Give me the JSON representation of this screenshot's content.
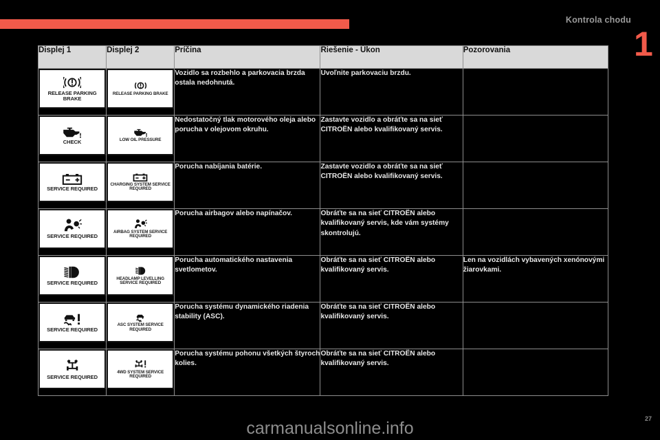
{
  "page": {
    "chapter_title": "Kontrola chodu",
    "chapter_number": "1",
    "page_number": "27",
    "watermark": "carmanualsonline.info",
    "accent_color": "#f15a4a",
    "header_bg": "#d9d9d9"
  },
  "table": {
    "headers": [
      "Displej 1",
      "Displej 2",
      "Príčina",
      "Riešenie - Úkon",
      "Pozorovania"
    ],
    "rows": [
      {
        "display1": {
          "icon": "brake-warning-icon",
          "caption": "RELEASE PARKING BRAKE"
        },
        "display2": {
          "icon": "brake-warning-icon",
          "caption": "RELEASE PARKING BRAKE"
        },
        "cause": "Vozidlo sa rozbehlo a parkovacia brzda ostala nedohnutá.",
        "solution": "Uvoľnite parkovaciu brzdu.",
        "note": ""
      },
      {
        "display1": {
          "icon": "oil-can-icon",
          "caption": "CHECK"
        },
        "display2": {
          "icon": "oil-can-icon",
          "caption": "LOW OIL PRESSURE"
        },
        "cause": "Nedostatočný tlak motorového oleja alebo porucha v olejovom okruhu.",
        "solution": "Zastavte vozidlo a obráťte sa na sieť CITROËN alebo kvalifikovaný servis.",
        "note": ""
      },
      {
        "display1": {
          "icon": "battery-icon",
          "caption": "SERVICE REQUIRED"
        },
        "display2": {
          "icon": "battery-icon",
          "caption": "CHARGING SYSTEM SERVICE REQUIRED"
        },
        "cause": "Porucha nabíjania batérie.",
        "solution": "Zastavte vozidlo a obráťte sa na sieť CITROËN alebo kvalifikovaný servis.",
        "note": ""
      },
      {
        "display1": {
          "icon": "airbag-icon",
          "caption": "SERVICE REQUIRED"
        },
        "display2": {
          "icon": "airbag-icon",
          "caption": "AIRBAG SYSTEM SERVICE REQUIRED"
        },
        "cause": "Porucha airbagov alebo napínačov.",
        "solution": "Obráťte sa na sieť CITROËN alebo kvalifikovaný servis, kde vám systémy skontrolujú.",
        "note": ""
      },
      {
        "display1": {
          "icon": "headlamp-levelling-icon",
          "caption": "SERVICE REQUIRED"
        },
        "display2": {
          "icon": "headlamp-levelling-icon",
          "caption": "HEADLAMP LEVELLING SERVICE REQUIRED"
        },
        "cause": "Porucha automatického nastavenia svetlometov.",
        "solution": "Obráťte sa na sieť CITROËN alebo kvalifikovaný servis.",
        "note": "Len na vozidlách vybavených xenónovými žiarovkami."
      },
      {
        "display1": {
          "icon": "asc-stability-icon",
          "caption": "SERVICE REQUIRED"
        },
        "display2": {
          "icon": "asc-stability-icon",
          "caption": "ASC SYSTEM SERVICE REQUIRED"
        },
        "cause": "Porucha systému dynamického riadenia stability (ASC).",
        "solution": "Obráťte sa na sieť CITROËN alebo kvalifikovaný servis.",
        "note": ""
      },
      {
        "display1": {
          "icon": "four-wheel-drive-icon",
          "caption": "SERVICE REQUIRED"
        },
        "display2": {
          "icon": "four-wheel-drive-icon",
          "caption": "4WD SYSTEM SERVICE REQUIRED"
        },
        "cause": "Porucha systému pohonu všetkých štyroch kolies.",
        "solution": "Obráťte sa na sieť CITROËN alebo kvalifikovaný servis.",
        "note": ""
      }
    ]
  }
}
